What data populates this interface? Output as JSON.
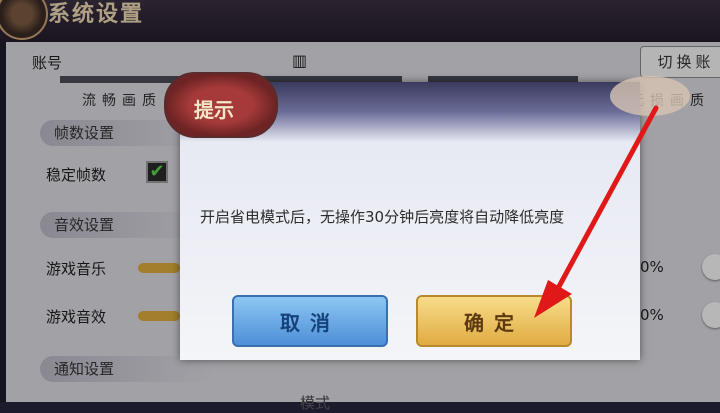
{
  "header": {
    "title": "系统设置"
  },
  "account": {
    "label": "账号",
    "switch_label": "切换账",
    "avatar_glyph": "▥"
  },
  "quality": {
    "smooth": "流畅画质",
    "high": "无损画质"
  },
  "frames": {
    "section": "帧数设置",
    "stable_label": "稳定帧数",
    "check_glyph": "✔"
  },
  "audio": {
    "section": "音效设置",
    "music_label": "游戏音乐",
    "music_pct": "0%",
    "sfx_label": "游戏音效",
    "sfx_pct": "0%"
  },
  "notify": {
    "section": "通知设置",
    "partial_item": "模式"
  },
  "dialog": {
    "title": "提示",
    "message": "开启省电模式后，无操作30分钟后亮度将自动降低亮度",
    "cancel_label": "取消",
    "confirm_label": "确定"
  },
  "colors": {
    "arrow": "#e01818",
    "confirm": "#e8b850",
    "cancel": "#5a9be0"
  }
}
